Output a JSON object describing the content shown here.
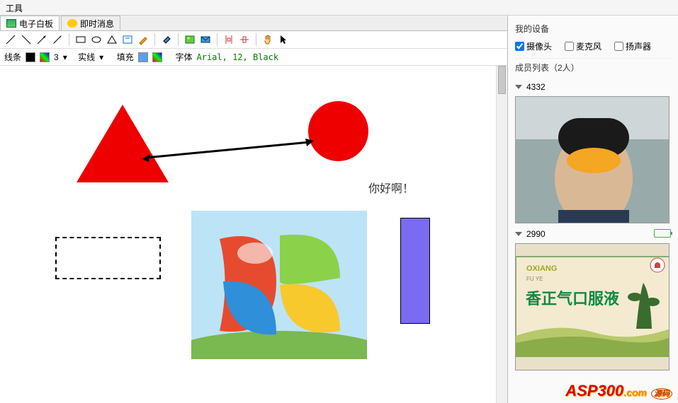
{
  "menubar": {
    "tools": "工具"
  },
  "tabs": {
    "whiteboard": "电子白板",
    "im": "即时消息"
  },
  "toolbar2": {
    "line_label": "线条",
    "line_width": "3",
    "style_label": "实线",
    "fill_label": "填充",
    "font_label": "字体",
    "font_value": "Arial, 12, Black"
  },
  "canvas": {
    "greeting": "你好啊！"
  },
  "right": {
    "my_devices": "我的设备",
    "camera": "摄像头",
    "mic": "麦克风",
    "speaker": "扬声器",
    "member_list": "成员列表（2人）",
    "members": [
      {
        "id": "4332"
      },
      {
        "id": "2990"
      }
    ]
  },
  "logo": {
    "main": "ASP300",
    "suffix": ".com",
    "badge": "源码"
  },
  "colors": {
    "line": "#000000",
    "fill": "#5aa0f0",
    "accent_red": "#e00000",
    "purple": "#7b6bf0"
  }
}
